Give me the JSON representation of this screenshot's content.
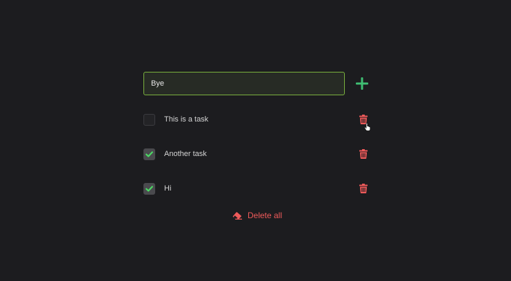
{
  "input": {
    "value": "Bye",
    "add_icon": "plus-icon"
  },
  "tasks": [
    {
      "label": "This is a task",
      "checked": false
    },
    {
      "label": "Another task",
      "checked": true
    },
    {
      "label": "Hi",
      "checked": true
    }
  ],
  "delete_all": {
    "label": "Delete all",
    "icon": "eraser-icon"
  },
  "colors": {
    "background": "#1c1c1f",
    "input_border": "#7bb33e",
    "add_green": "#3fbf73",
    "check_green": "#4cd964",
    "danger_red": "#ef5a5a"
  }
}
